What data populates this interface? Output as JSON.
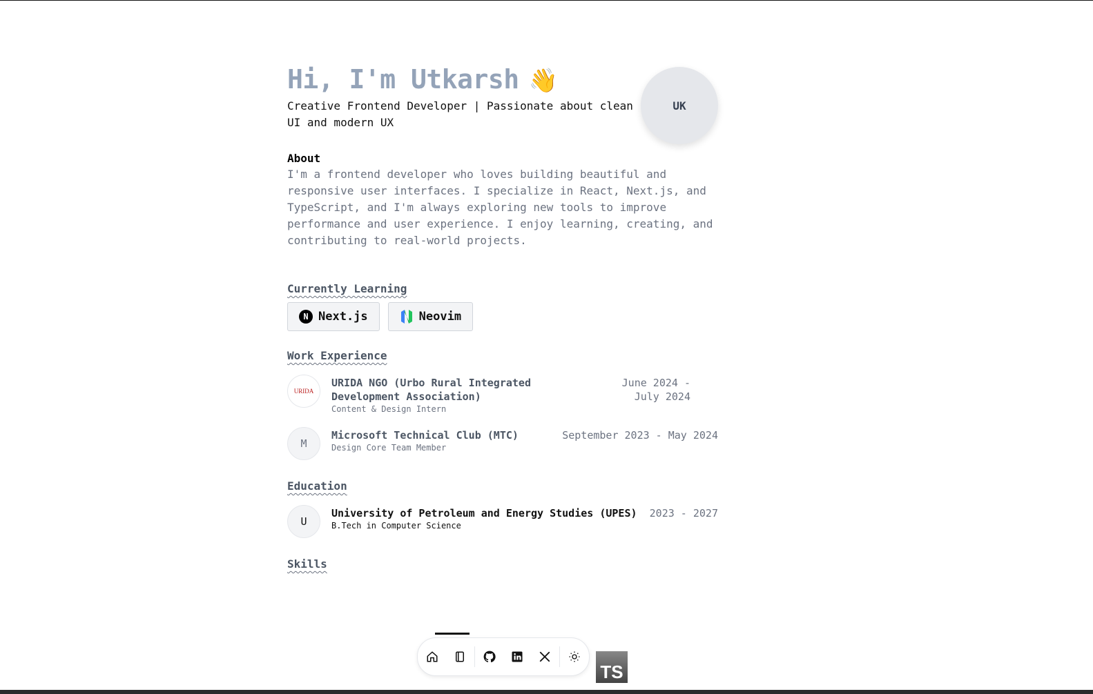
{
  "hero": {
    "greeting": "Hi, I'm Utkarsh",
    "wave": "👋",
    "tagline": "Creative Frontend Developer | Passionate about clean UI and modern UX",
    "avatar_initials": "UK"
  },
  "about": {
    "heading": "About",
    "text": "I'm a frontend developer who loves building beautiful and responsive user interfaces. I specialize in React, Next.js, and TypeScript, and I'm always exploring new tools to improve performance and user experience. I enjoy learning, creating, and contributing to real-world projects."
  },
  "learning": {
    "heading": "Currently Learning",
    "items": [
      {
        "label": "Next.js",
        "icon": "nextjs-icon",
        "glyph": "N"
      },
      {
        "label": "Neovim",
        "icon": "neovim-icon",
        "glyph": "N"
      }
    ]
  },
  "work": {
    "heading": "Work Experience",
    "items": [
      {
        "logo": "URIDA",
        "title": "URIDA NGO (Urbo Rural Integrated Development Association)",
        "role": "Content & Design Intern",
        "date": "June 2024 - July 2024"
      },
      {
        "logo": "M",
        "title": "Microsoft Technical Club (MTC)",
        "role": "Design Core Team Member",
        "date": "September 2023 - May 2024"
      }
    ]
  },
  "education": {
    "heading": "Education",
    "items": [
      {
        "logo": "U",
        "title": "University of Petroleum and Energy Studies (UPES)",
        "role": "B.Tech in Computer Science",
        "date": "2023 - 2027"
      }
    ]
  },
  "skills": {
    "heading": "Skills",
    "badge": "TS"
  },
  "dock": {
    "items": [
      "home-icon",
      "notebook-icon",
      "github-icon",
      "linkedin-icon",
      "x-icon",
      "sun-icon"
    ]
  }
}
